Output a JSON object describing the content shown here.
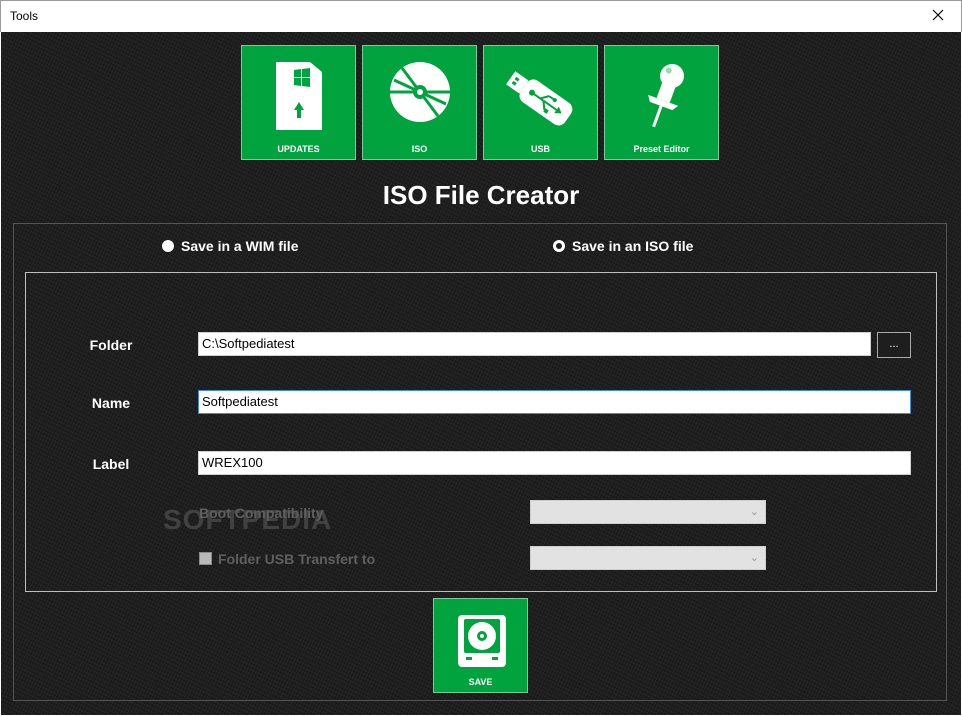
{
  "window": {
    "title": "Tools",
    "close_glyph": "✕"
  },
  "tiles": [
    {
      "label": "UPDATES",
      "icon": "windows-sd-card-update-icon"
    },
    {
      "label": "ISO",
      "icon": "disc-icon"
    },
    {
      "label": "USB",
      "icon": "usb-drive-icon"
    },
    {
      "label": "Preset Editor",
      "icon": "pushpin-icon"
    }
  ],
  "heading": "ISO File Creator",
  "save_options": {
    "wim_label": "Save in a WIM file",
    "iso_label": "Save in an ISO file",
    "selected": "iso"
  },
  "form": {
    "folder_label": "Folder",
    "folder_value": "C:\\Softpediatest",
    "browse_label": "...",
    "name_label": "Name",
    "name_value": "Softpediatest",
    "label_label": "Label",
    "label_value": "WREX100",
    "boot_compat_label": "Boot Compatibility",
    "usb_transfer_label": "Folder USB Transfert to",
    "boot_compat_value": "",
    "usb_transfer_value": ""
  },
  "watermark": "SOFTPEDIA",
  "save_button": {
    "label": "SAVE",
    "icon": "hard-disk-icon"
  },
  "colors": {
    "accent": "#00a33d",
    "background": "#1e1e1e",
    "text": "#ffffff",
    "disabled_text": "#5f5f5f"
  }
}
